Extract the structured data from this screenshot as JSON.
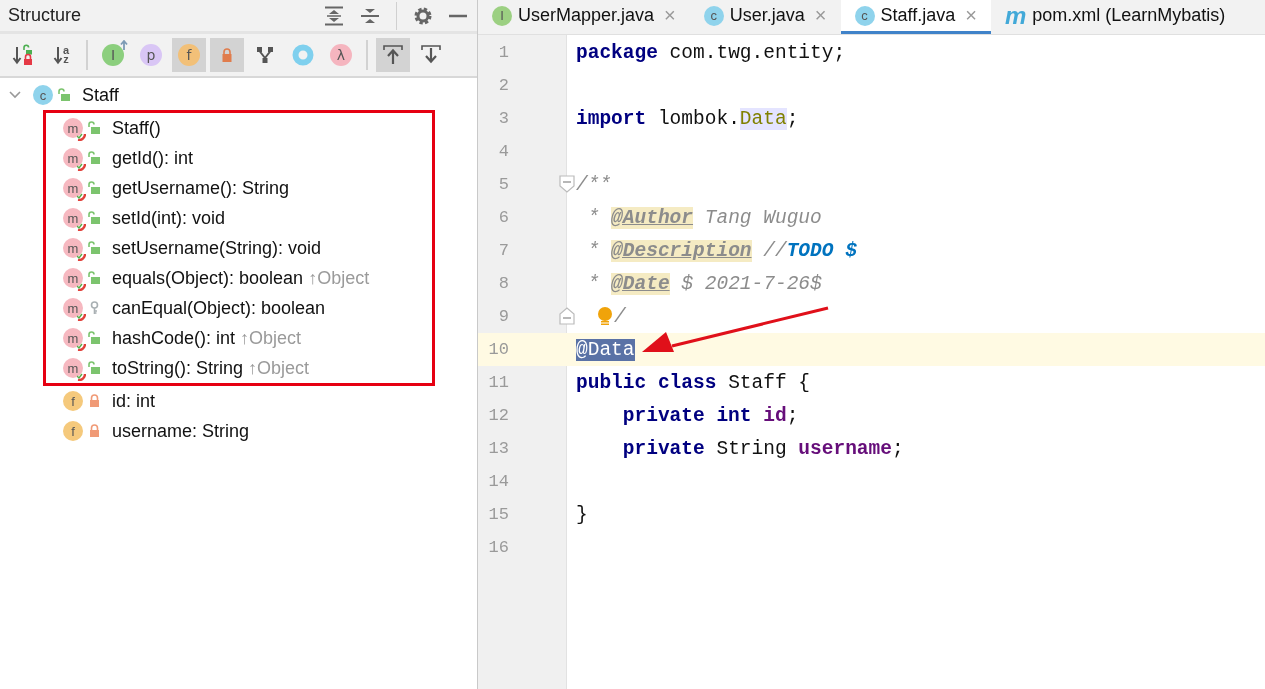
{
  "structure": {
    "title": "Structure",
    "header_buttons": [
      {
        "kind": "expand-all"
      },
      {
        "kind": "collapse-all"
      },
      {
        "kind": "settings"
      },
      {
        "kind": "minimize"
      }
    ],
    "toolbar_groups": [
      {
        "buttons": [
          {
            "kind": "sort-visibility",
            "selected": false
          },
          {
            "kind": "sort-alpha",
            "glyphs": [
              "a",
              "z"
            ],
            "selected": false
          }
        ]
      },
      {
        "buttons": [
          {
            "kind": "inherited",
            "glyph": "I",
            "color": "#8ccf7e",
            "selected": false
          },
          {
            "kind": "badge",
            "glyph": "p",
            "color": "#d9c6f5",
            "selected": false
          },
          {
            "kind": "badge",
            "glyph": "f",
            "color": "#f2c078",
            "selected": true
          },
          {
            "kind": "lock",
            "selected": true
          },
          {
            "kind": "fork",
            "selected": false
          },
          {
            "kind": "ring",
            "color": "#7fd0ee",
            "selected": false
          },
          {
            "kind": "badge",
            "glyph": "λ",
            "color": "#f5b5bf",
            "selected": false
          }
        ]
      },
      {
        "buttons": [
          {
            "kind": "scroll-to-source",
            "selected": true
          },
          {
            "kind": "scroll-from-source",
            "selected": false
          }
        ]
      }
    ],
    "tree": [
      {
        "label": "Staff",
        "kind": "public-class",
        "badge": "c",
        "expanded": true,
        "children": [
          {
            "label": "Staff()",
            "kind": "public-method",
            "badge": "m",
            "highlighted": true
          },
          {
            "label": "getId(): int",
            "kind": "public-method",
            "badge": "m",
            "highlighted": true
          },
          {
            "label": "getUsername(): String",
            "kind": "public-method",
            "badge": "m",
            "highlighted": true
          },
          {
            "label": "setId(int): void",
            "kind": "public-method",
            "badge": "m",
            "highlighted": true
          },
          {
            "label": "setUsername(String): void",
            "kind": "public-method",
            "badge": "m",
            "highlighted": true
          },
          {
            "label": "equals(Object): boolean",
            "inherited": "↑Object",
            "kind": "public-method",
            "badge": "m",
            "highlighted": true
          },
          {
            "label": "canEqual(Object): boolean",
            "kind": "protected-method",
            "badge": "m",
            "highlighted": true
          },
          {
            "label": "hashCode(): int",
            "inherited": "↑Object",
            "kind": "public-method",
            "badge": "m",
            "highlighted": true
          },
          {
            "label": "toString(): String",
            "inherited": "↑Object",
            "kind": "public-method",
            "badge": "m",
            "highlighted": true
          },
          {
            "label": "id: int",
            "kind": "private-field",
            "badge": "f",
            "highlighted": false
          },
          {
            "label": "username: String",
            "kind": "private-field",
            "badge": "f",
            "highlighted": false
          }
        ]
      }
    ]
  },
  "editor": {
    "tabs": [
      {
        "label": "UserMapper.java",
        "kind": "interface",
        "badge": "I",
        "close": "×",
        "selected": false
      },
      {
        "label": "User.java",
        "kind": "class",
        "badge": "c",
        "close": "×",
        "selected": false
      },
      {
        "label": "Staff.java",
        "kind": "class",
        "badge": "c",
        "close": "×",
        "selected": true
      },
      {
        "label": "pom.xml (LearnMybatis)",
        "kind": "maven",
        "badge": "m",
        "selected": false
      }
    ],
    "lines": [
      {
        "number": "1",
        "current": false,
        "tokens": [
          {
            "text": "package",
            "kind": "keyword"
          },
          {
            "text": " com.twg.entity;",
            "kind": "plain"
          }
        ]
      },
      {
        "number": "2",
        "current": false
      },
      {
        "number": "3",
        "current": false,
        "tokens": [
          {
            "text": "import",
            "kind": "keyword"
          },
          {
            "text": " lombok.",
            "kind": "plain"
          },
          {
            "text": "Data",
            "kind": "usage"
          },
          {
            "text": ";",
            "kind": "plain"
          }
        ]
      },
      {
        "number": "4",
        "current": false
      },
      {
        "number": "5",
        "current": false,
        "kind": "fold-start",
        "tokens": [
          {
            "text": "/**",
            "kind": "doc"
          }
        ]
      },
      {
        "number": "6",
        "current": false,
        "tokens": [
          {
            "text": " * ",
            "kind": "doc"
          },
          {
            "text": "@Author",
            "kind": "doc-tag"
          },
          {
            "text": " Tang Wuguo",
            "kind": "doc"
          }
        ]
      },
      {
        "number": "7",
        "current": false,
        "tokens": [
          {
            "text": " * ",
            "kind": "doc"
          },
          {
            "text": "@Description",
            "kind": "doc-tag"
          },
          {
            "text": " //",
            "kind": "doc"
          },
          {
            "text": "TODO $",
            "kind": "todo"
          }
        ]
      },
      {
        "number": "8",
        "current": false,
        "tokens": [
          {
            "text": " * ",
            "kind": "doc"
          },
          {
            "text": "@Date",
            "kind": "doc-tag"
          },
          {
            "text": " $ 2021-7-26$",
            "kind": "doc"
          }
        ]
      },
      {
        "number": "9",
        "current": false,
        "kind": "fold-end",
        "tokens": [
          {
            "kind": "bulb"
          },
          {
            "text": "/",
            "kind": "doc"
          }
        ]
      },
      {
        "number": "10",
        "current": true,
        "tokens": [
          {
            "text": "@Data",
            "kind": "selection"
          }
        ]
      },
      {
        "number": "11",
        "current": false,
        "tokens": [
          {
            "text": "public class",
            "kind": "keyword"
          },
          {
            "text": " Staff {",
            "kind": "plain"
          }
        ]
      },
      {
        "number": "12",
        "current": false,
        "tokens": [
          {
            "text": "    private int",
            "kind": "keyword"
          },
          {
            "text": " id",
            "kind": "field"
          },
          {
            "text": ";",
            "kind": "plain"
          }
        ]
      },
      {
        "number": "13",
        "current": false,
        "tokens": [
          {
            "text": "    private",
            "kind": "keyword"
          },
          {
            "text": " String ",
            "kind": "plain"
          },
          {
            "text": "username",
            "kind": "field"
          },
          {
            "text": ";",
            "kind": "plain"
          }
        ]
      },
      {
        "number": "14",
        "current": false
      },
      {
        "number": "15",
        "current": false,
        "tokens": [
          {
            "text": "}",
            "kind": "plain"
          }
        ]
      },
      {
        "number": "16",
        "current": false
      }
    ]
  }
}
